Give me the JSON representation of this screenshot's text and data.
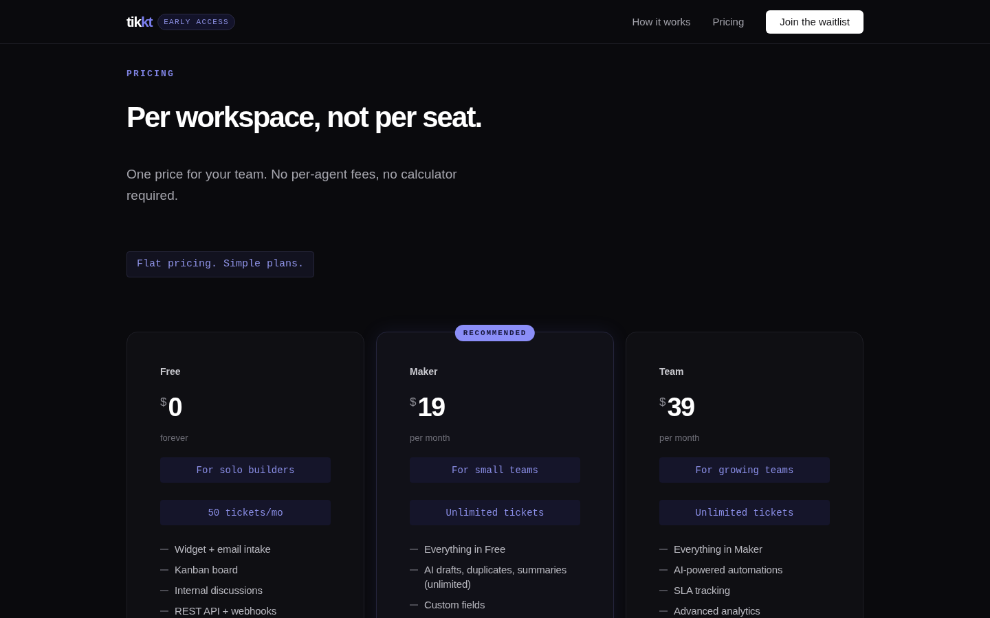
{
  "nav": {
    "logo": {
      "text": "tik",
      "accent": "kt"
    },
    "badge": "EARLY ACCESS",
    "links": [
      {
        "label": "How it works"
      },
      {
        "label": "Pricing"
      }
    ],
    "cta": "Join the waitlist"
  },
  "hero": {
    "eyebrow": "PRICING",
    "title": "Per workspace, not per seat.",
    "subtitle": "One price for your team. No per-agent fees, no calculator required.",
    "tag": "Flat pricing. Simple plans."
  },
  "plans": [
    {
      "name": "Free",
      "currency": "$",
      "price": "0",
      "period": "forever",
      "audience": "For solo builders",
      "tickets": "50 tickets/mo",
      "featured": false,
      "features": [
        "Widget + email intake",
        "Kanban board",
        "Internal discussions",
        "REST API + webhooks"
      ]
    },
    {
      "name": "Maker",
      "badge": "RECOMMENDED",
      "currency": "$",
      "price": "19",
      "period": "per month",
      "audience": "For small teams",
      "tickets": "Unlimited tickets",
      "featured": true,
      "features": [
        "Everything in Free",
        "AI drafts, duplicates, summaries (unlimited)",
        "Custom fields"
      ]
    },
    {
      "name": "Team",
      "currency": "$",
      "price": "39",
      "period": "per month",
      "audience": "For growing teams",
      "tickets": "Unlimited tickets",
      "featured": false,
      "features": [
        "Everything in Maker",
        "AI-powered automations",
        "SLA tracking",
        "Advanced analytics"
      ]
    }
  ]
}
